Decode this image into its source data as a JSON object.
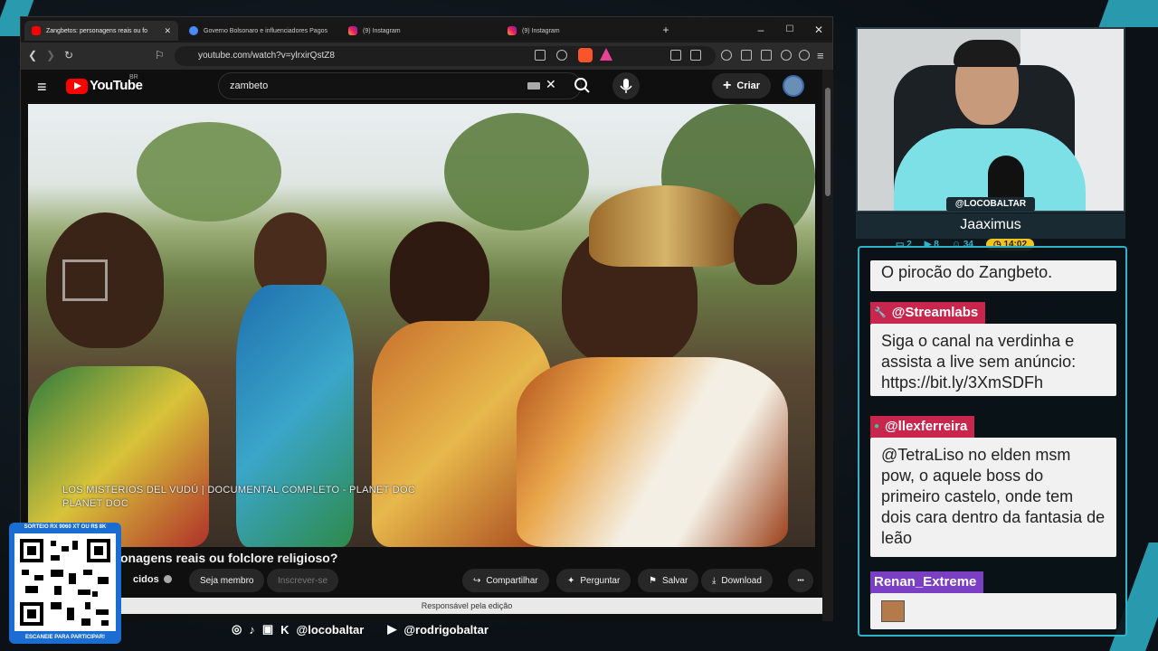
{
  "browser": {
    "tabs": [
      {
        "title": "Zangbetos: personagens reais ou fo",
        "active": true
      },
      {
        "title": "Governo Bolsonaro e influenciadores Pagos",
        "active": false
      },
      {
        "title": "(9) Instagram",
        "active": false
      },
      {
        "title": "(9) Instagram",
        "active": false
      }
    ],
    "new_tab": "+",
    "url": "youtube.com/watch?v=ylrxirQstZ8"
  },
  "youtube": {
    "logo": "YouTube",
    "region": "BR",
    "search_value": "zambeto",
    "create_label": "Criar",
    "video_caption_line1": "LOS MISTERIOS DEL VUDÚ | DOCUMENTAL COMPLETO - PLANET DOC",
    "video_caption_line2": "PLANET DOC",
    "video_title": "onagens reais ou folclore religioso?",
    "channel_partial": "cidos",
    "join_label": "Seja membro",
    "subscribe_label": "Inscrever-se",
    "share_label": "Compartilhar",
    "ask_label": "Perguntar",
    "save_label": "Salvar",
    "download_label": "Download",
    "more_label": "•••",
    "tooltip": "Responsável pela edição"
  },
  "stream": {
    "cam_tag": "@LOCOBALTAR",
    "viewer_name": "Jaaximus",
    "stats": [
      {
        "icon": "chat-icon",
        "value": "2"
      },
      {
        "icon": "video-icon",
        "value": "8"
      },
      {
        "icon": "users-icon",
        "value": "34"
      },
      {
        "icon": "clock-icon",
        "value": "14:02"
      }
    ],
    "chat": [
      {
        "user": "",
        "text": "O pirocão do Zangbeto."
      },
      {
        "user": "@Streamlabs",
        "color": "#c8264d",
        "text": "Siga o canal na verdinha e assista a live sem anúncio: https://bit.ly/3XmSDFh"
      },
      {
        "user": "@llexferreira",
        "color": "#c8264d",
        "text": "@TetraLiso no elden msm pow, o aquele boss do primeiro castelo, onde tem dois cara dentro da fantasia de leão"
      },
      {
        "user": "Renan_Extreme",
        "color": "#7b3fc4",
        "text": ""
      }
    ],
    "qr_header": "SORTEIO RX 9060 XT OU R$ 8K",
    "qr_footer": "ESCANEIE PARA PARTICIPAR!",
    "socials_handle1": "@locobaltar",
    "socials_handle2": "@rodrigobaltar"
  }
}
